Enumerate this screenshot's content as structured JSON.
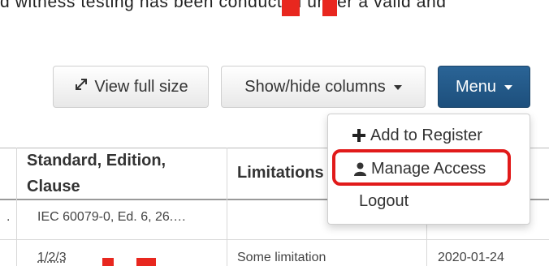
{
  "intro_text": "d witness testing has been conducted under a valid and",
  "toolbar": {
    "view_full_size": "View full size",
    "show_hide_columns": "Show/hide columns",
    "menu": "Menu"
  },
  "table": {
    "headers": {
      "standard": "Standard, Edition, Clause",
      "limitations": "Limitations"
    },
    "rows": [
      {
        "lead": ".",
        "standard": "IEC 60079-0, Ed. 6, 26.…",
        "limitations": "",
        "date": ""
      },
      {
        "lead": "",
        "standard": "1/2/3",
        "limitations": "Some limitation",
        "date": "2020-01-24"
      }
    ]
  },
  "menu_dropdown": {
    "items": [
      {
        "label": "Add to Register",
        "icon": "plus-icon"
      },
      {
        "label": "Manage Access",
        "icon": "user-icon"
      },
      {
        "label": "Logout",
        "icon": ""
      }
    ]
  },
  "colors": {
    "menu_button": "#1d4f7c",
    "highlight": "#e11a1a",
    "accent_mark": "#e8271f"
  }
}
